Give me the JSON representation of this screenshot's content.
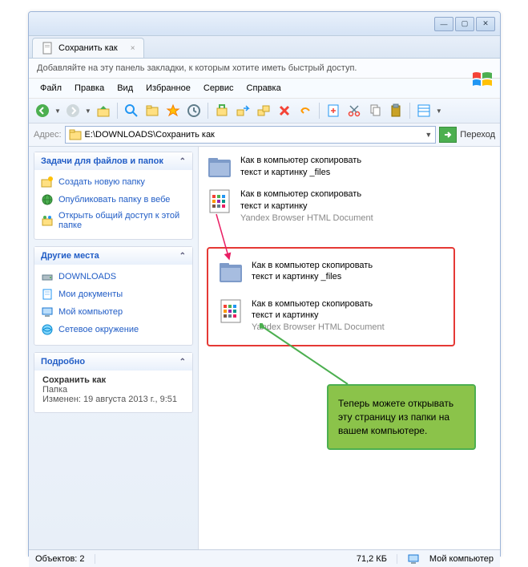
{
  "tab": {
    "title": "Сохранить как"
  },
  "bookmark_hint": "Добавляйте на эту панель закладки, к которым хотите иметь быстрый доступ.",
  "menu": {
    "file": "Файл",
    "edit": "Правка",
    "view": "Вид",
    "favorites": "Избранное",
    "tools": "Сервис",
    "help": "Справка"
  },
  "address": {
    "label": "Адрес:",
    "value": "E:\\DOWNLOADS\\Сохранить как",
    "go": "Переход"
  },
  "sidebar": {
    "tasks": {
      "title": "Задачи для файлов и папок",
      "items": [
        "Создать новую папку",
        "Опубликовать папку в вебе",
        "Открыть общий доступ к этой папке"
      ]
    },
    "places": {
      "title": "Другие места",
      "items": [
        "DOWNLOADS",
        "Мои документы",
        "Мой компьютер",
        "Сетевое окружение"
      ]
    },
    "details": {
      "title": "Подробно",
      "name": "Сохранить как",
      "type": "Папка",
      "modified": "Изменен: 19 августа 2013 г., 9:51"
    }
  },
  "files": {
    "folder": {
      "line1": "Как в компьютер скопировать",
      "line2": "текст и картинку _files"
    },
    "html": {
      "line1": "Как в компьютер скопировать",
      "line2": "текст и картинку",
      "sub": "Yandex Browser HTML Document"
    }
  },
  "callout": {
    "folder": {
      "line1": "Как в компьютер скопировать",
      "line2": "текст и картинку _files"
    },
    "html": {
      "line1": "Как в компьютер скопировать",
      "line2": "текст и картинку",
      "sub": "Yandex Browser HTML Document"
    }
  },
  "annotation": "Теперь можете открывать эту страницу из папки на вашем компьютере.",
  "status": {
    "objects": "Объектов: 2",
    "size": "71,2 КБ",
    "location": "Мой компьютер"
  }
}
